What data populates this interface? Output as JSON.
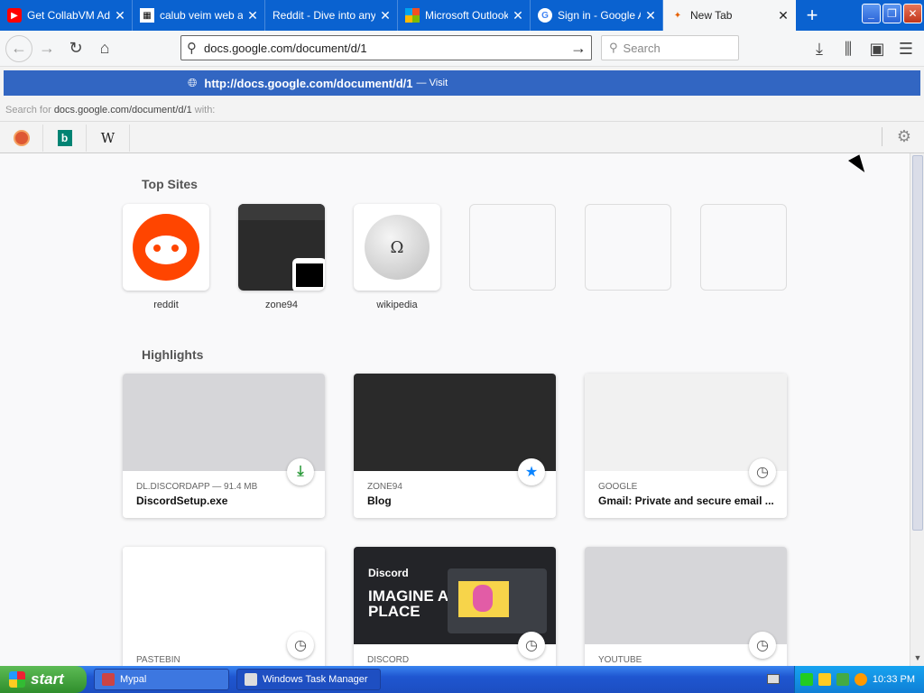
{
  "tabs": [
    {
      "title": "Get CollabVM Adm",
      "favicon": "youtube-icon",
      "color": "#ff0000"
    },
    {
      "title": "calub veim web ap",
      "favicon": "page-icon",
      "color": "#ffffff"
    },
    {
      "title": "Reddit - Dive into anyth",
      "favicon": "reddit-icon",
      "color": "#ff4500"
    },
    {
      "title": "Microsoft Outlook",
      "favicon": "microsoft-icon",
      "color": "#f25022"
    },
    {
      "title": "Sign in - Google Ac",
      "favicon": "google-icon",
      "color": "#4285f4"
    },
    {
      "title": "New Tab",
      "favicon": "firefox-icon",
      "color": "#e66000",
      "active": true
    }
  ],
  "urlbar": {
    "value": "docs.google.com/document/d/1"
  },
  "search": {
    "placeholder": "Search"
  },
  "popup": {
    "suggest_url": "http://docs.google.com/document/d/1",
    "suggest_action": "— Visit",
    "search_for_prefix": "Search for",
    "search_for_query": "docs.google.com/document/d/1",
    "search_for_suffix": "with:",
    "engines": [
      "DuckDuckGo",
      "Bing",
      "W"
    ]
  },
  "top_sites": {
    "heading": "Top Sites",
    "items": [
      {
        "label": "reddit"
      },
      {
        "label": "zone94"
      },
      {
        "label": "wikipedia"
      },
      {
        "label": ""
      },
      {
        "label": ""
      },
      {
        "label": ""
      }
    ]
  },
  "highlights": {
    "heading": "Highlights",
    "cards": [
      {
        "source": "DL.DISCORDAPP — 91.4 MB",
        "title": "DiscordSetup.exe",
        "badge": "download-icon"
      },
      {
        "source": "ZONE94",
        "title": "Blog",
        "badge": "bookmark-star-icon"
      },
      {
        "source": "GOOGLE",
        "title": "Gmail: Private and secure email ...",
        "badge": "history-clock-icon"
      },
      {
        "source": "PASTEBIN",
        "title": "",
        "badge": "history-clock-icon"
      },
      {
        "source": "DISCORD",
        "title": "",
        "badge": "history-clock-icon"
      },
      {
        "source": "YOUTUBE",
        "title": "",
        "badge": "history-clock-icon"
      }
    ],
    "discord_brand": "Discord",
    "discord_tagline": "IMAGINE A PLACE"
  },
  "taskbar": {
    "start_label": "start",
    "items": [
      "Mypal",
      "Windows Task Manager"
    ],
    "clock": "10:33 PM"
  }
}
